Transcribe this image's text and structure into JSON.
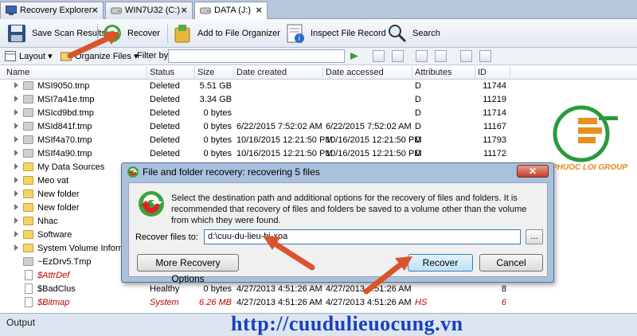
{
  "tabs": [
    {
      "label": "Recovery Explorer",
      "active": false
    },
    {
      "label": "WIN7U32 (C:)",
      "active": false
    },
    {
      "label": "DATA (J:)",
      "active": true
    }
  ],
  "toolbar": {
    "save_scan": "Save Scan Results",
    "recover": "Recover",
    "add_organizer": "Add to File Organizer",
    "inspect": "Inspect File Record",
    "search": "Search"
  },
  "filterbar": {
    "layout": "Layout",
    "organize": "Organize Files",
    "filter_label": "Filter by:",
    "filter_value": ""
  },
  "columns": [
    "Name",
    "Status",
    "Size",
    "Date created",
    "Date accessed",
    "Attributes",
    "ID"
  ],
  "rows": [
    {
      "name": "MSI9050.tmp",
      "status": "Deleted",
      "size": "5.51 GB",
      "created": "",
      "accessed": "",
      "attr": "D",
      "id": "11744",
      "icon": "folder-gray",
      "exp": true,
      "red": false
    },
    {
      "name": "MSI7a41e.tmp",
      "status": "Deleted",
      "size": "3.34 GB",
      "created": "",
      "accessed": "",
      "attr": "D",
      "id": "11219",
      "icon": "folder-gray",
      "exp": true,
      "red": false
    },
    {
      "name": "MSIcd9bd.tmp",
      "status": "Deleted",
      "size": "0 bytes",
      "created": "",
      "accessed": "",
      "attr": "D",
      "id": "11714",
      "icon": "folder-gray",
      "exp": true,
      "red": false
    },
    {
      "name": "MSId841f.tmp",
      "status": "Deleted",
      "size": "0 bytes",
      "created": "6/22/2015 7:52:02 AM",
      "accessed": "6/22/2015 7:52:02 AM",
      "attr": "D",
      "id": "11167",
      "icon": "folder-gray",
      "exp": true,
      "red": false
    },
    {
      "name": "MSIf4a70.tmp",
      "status": "Deleted",
      "size": "0 bytes",
      "created": "10/16/2015 12:21:50 PM",
      "accessed": "10/16/2015 12:21:50 PM",
      "attr": "D",
      "id": "11793",
      "icon": "folder-gray",
      "exp": true,
      "red": false
    },
    {
      "name": "MSIf4a90.tmp",
      "status": "Deleted",
      "size": "0 bytes",
      "created": "10/16/2015 12:21:50 PM",
      "accessed": "10/16/2015 12:21:50 PM",
      "attr": "D",
      "id": "11172",
      "icon": "folder-gray",
      "exp": true,
      "red": false
    },
    {
      "name": "My Data Sources",
      "status": "",
      "size": "",
      "created": "",
      "accessed": "",
      "attr": "",
      "id": "",
      "icon": "folder-yellow",
      "exp": true,
      "red": false
    },
    {
      "name": "Meo vat",
      "status": "",
      "size": "",
      "created": "",
      "accessed": "",
      "attr": "",
      "id": "",
      "icon": "folder-yellow",
      "exp": true,
      "red": false
    },
    {
      "name": "New folder",
      "status": "",
      "size": "",
      "created": "",
      "accessed": "",
      "attr": "",
      "id": "",
      "icon": "folder-yellow",
      "exp": true,
      "red": false
    },
    {
      "name": "New folder",
      "status": "",
      "size": "",
      "created": "",
      "accessed": "",
      "attr": "",
      "id": "",
      "icon": "folder-yellow",
      "exp": true,
      "red": false
    },
    {
      "name": "Nhac",
      "status": "",
      "size": "",
      "created": "",
      "accessed": "",
      "attr": "",
      "id": "",
      "icon": "folder-yellow",
      "exp": true,
      "red": false
    },
    {
      "name": "Software",
      "status": "",
      "size": "",
      "created": "",
      "accessed": "",
      "attr": "",
      "id": "",
      "icon": "folder-yellow",
      "exp": true,
      "red": false
    },
    {
      "name": "System Volume Informa",
      "status": "",
      "size": "",
      "created": "",
      "accessed": "",
      "attr": "",
      "id": "",
      "icon": "folder-yellow",
      "exp": true,
      "red": false
    },
    {
      "name": "~EzDrv5.Tmp",
      "status": "",
      "size": "",
      "created": "",
      "accessed": "",
      "attr": "",
      "id": "",
      "icon": "folder-gray",
      "exp": false,
      "red": false
    },
    {
      "name": "$AttrDef",
      "status": "",
      "size": "",
      "created": "",
      "accessed": "",
      "attr": "",
      "id": "",
      "icon": "doc",
      "exp": false,
      "red": true
    },
    {
      "name": "$BadClus",
      "status": "Healthy",
      "size": "0 bytes",
      "created": "4/27/2013 4:51:26 AM",
      "accessed": "4/27/2013 4:51:26 AM",
      "attr": "",
      "id": "8",
      "icon": "doc",
      "exp": false,
      "red": false
    },
    {
      "name": "$Bitmap",
      "status": "System",
      "size": "6.26 MB",
      "created": "4/27/2013 4:51:26 AM",
      "accessed": "4/27/2013 4:51:26 AM",
      "attr": "HS",
      "id": "6",
      "icon": "doc",
      "exp": false,
      "red": true
    }
  ],
  "dialog": {
    "title": "File and folder recovery: recovering 5 files",
    "close": "✕",
    "description": "Select the destination path and additional options for the recovery of files and folders.  It is recommended that recovery of files and folders be saved to a volume other than the volume from which they were found.",
    "path_label": "Recover files to:",
    "path_value": "d:\\cuu-du-lieu-bi-xoa",
    "browse": "...",
    "more_options": "More Recovery Options",
    "recover": "Recover",
    "cancel": "Cancel"
  },
  "output": {
    "label": "Output"
  },
  "watermark": {
    "url": "http://cuudulieuocung.vn",
    "logo_text": "PHUOC LOI GROUP"
  },
  "colors": {
    "accent": "#3c7fb1",
    "deleted_red": "#c00000",
    "arrow": "#d9542b"
  }
}
